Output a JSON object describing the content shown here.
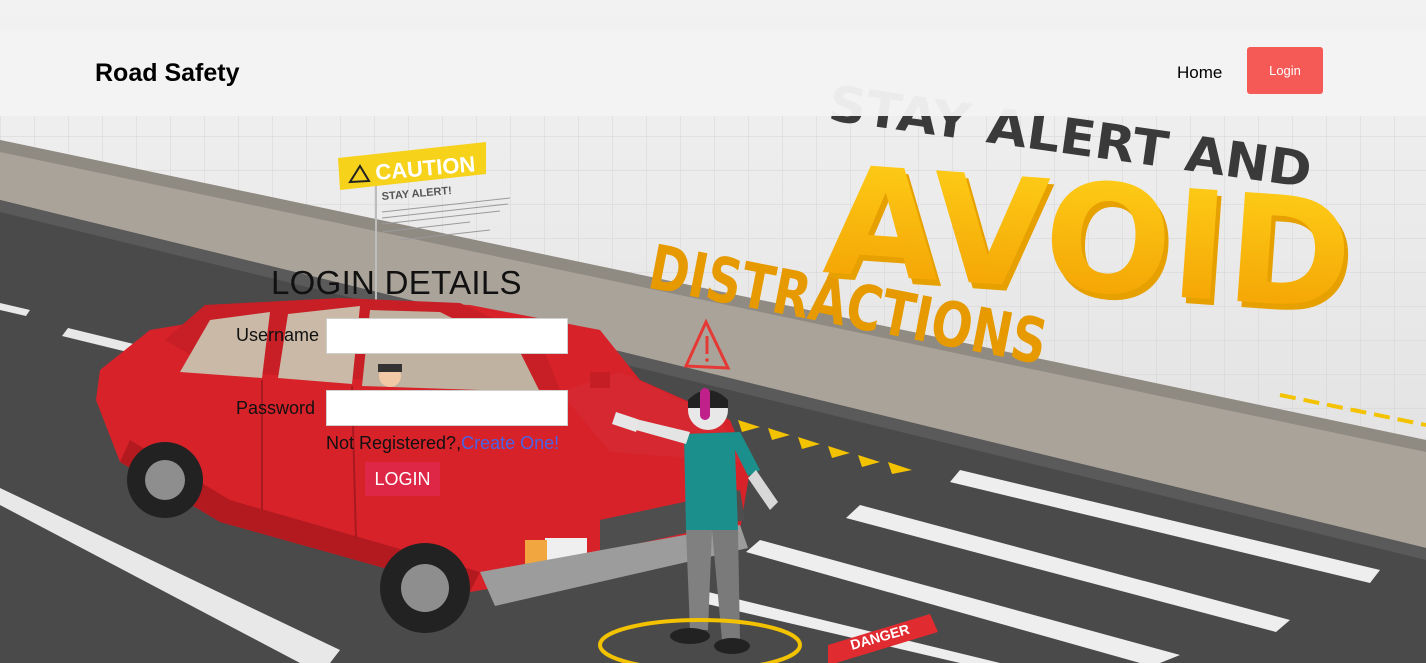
{
  "header": {
    "brand": "Road Safety",
    "nav": {
      "home": "Home",
      "login": "Login"
    }
  },
  "hero": {
    "headline_top": "STAY ALERT AND",
    "headline_main": "AVOID",
    "headline_sub": "DISTRACTIONS",
    "caution_sign": "CAUTION",
    "caution_subtitle": "STAY ALERT!",
    "danger_tag": "DANGER"
  },
  "login": {
    "title": "LOGIN DETAILS",
    "username_label": "Username",
    "password_label": "Password",
    "not_registered": "Not Registered?,",
    "create_link": "Create One!",
    "submit_label": "LOGIN"
  },
  "colors": {
    "nav_login_bg": "#f55a56",
    "submit_bg": "#de2646",
    "link": "#4a63e6",
    "headline_yellow": "#f7b500"
  }
}
